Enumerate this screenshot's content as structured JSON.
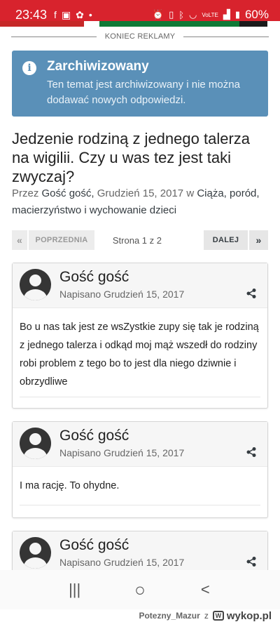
{
  "status_bar": {
    "time": "23:43",
    "battery": "60%",
    "signal_text": "VoLTE",
    "left_icons": [
      "facebook-icon",
      "gallery-icon",
      "notification-icon",
      "dot-icon"
    ],
    "right_icons": [
      "alarm-icon",
      "vibrate-icon",
      "bluetooth-icon",
      "wifi-icon",
      "signal-icon",
      "battery-icon"
    ]
  },
  "ad": {
    "end_label": "KONIEC REKLAMY"
  },
  "notice": {
    "title": "Zarchiwizowany",
    "body": "Ten temat jest archiwizowany i nie można dodawać nowych odpowiedzi.",
    "color": "#5a90b8"
  },
  "topic": {
    "title": "Jedzenie rodziną z jednego talerza na wigilii. Czy u was tez jest taki zwyczaj?",
    "by_prefix": "Przez",
    "author": "Gość gość,",
    "date": "Grudzień 15, 2017",
    "in_word": "w",
    "forum": "Ciąża, poród, macierzyństwo i wychowanie dzieci"
  },
  "pagination": {
    "first_icon": "«",
    "prev_label": "POPRZEDNIA",
    "page_info": "Strona 1 z 2",
    "next_label": "DALEJ",
    "last_icon": "»"
  },
  "posts": [
    {
      "author": "Gość gość",
      "date": "Napisano Grudzień 15, 2017",
      "body": "Bo u nas tak jest ze wsZystkie zupy się tak je rodziną z jednego talerza i odkąd moj mąż wszedł do rodziny robi problem z tego bo to jest dla niego dziwnie i obrzydliwe"
    },
    {
      "author": "Gość gość",
      "date": "Napisano Grudzień 15, 2017",
      "body": "I ma rację. To ohydne."
    },
    {
      "author": "Gość gość",
      "date": "Napisano Grudzień 15, 2017",
      "body": ""
    }
  ],
  "navbar": {
    "recents": "|||",
    "home": "○",
    "back": "<"
  },
  "watermark": {
    "user": "Potezny_Mazur",
    "z": "z",
    "site": "wykop.pl"
  },
  "colors": {
    "status_bar": "#d8232d",
    "notice": "#5a90b8",
    "text": "#353c41"
  }
}
